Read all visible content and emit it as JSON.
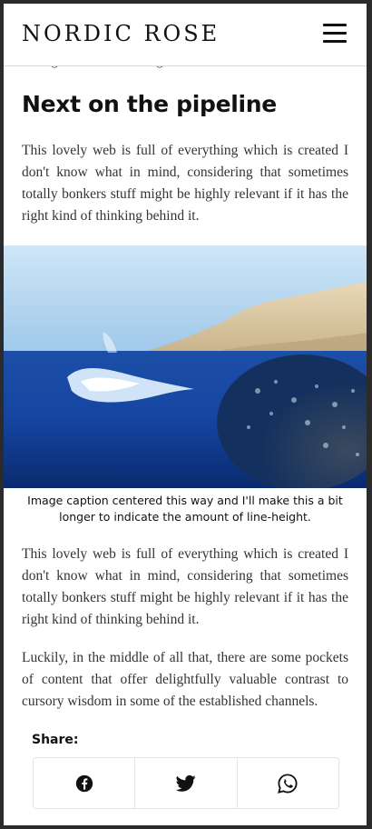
{
  "header": {
    "brand": "NORDIC ROSE",
    "menu_icon": "hamburger-menu-icon"
  },
  "article": {
    "cutoff_line": "the right kind of thinking behind it.",
    "section_title": "Next on the pipeline",
    "paragraph_1": "This lovely web is full of everything which is created I don't know what in mind, considering that sometimes totally bonkers stuff might be highly relevant if it has the right kind of thinking behind it.",
    "image_caption": "Image caption centered this way and I'll make this a bit longer to indicate the amount of line-height.",
    "paragraph_2": "This lovely web is full of everything which is created I don't know what in mind, considering that sometimes totally bonkers stuff might be highly relevant if it has the right kind of thinking behind it.",
    "paragraph_3": "Luckily, in the middle of all that, there are some pockets of content that offer delightfully valuable contrast to cursory wisdom in some of the established channels."
  },
  "share": {
    "label": "Share:",
    "buttons": [
      {
        "icon": "facebook-icon"
      },
      {
        "icon": "twitter-icon"
      },
      {
        "icon": "whatsapp-icon"
      }
    ]
  }
}
